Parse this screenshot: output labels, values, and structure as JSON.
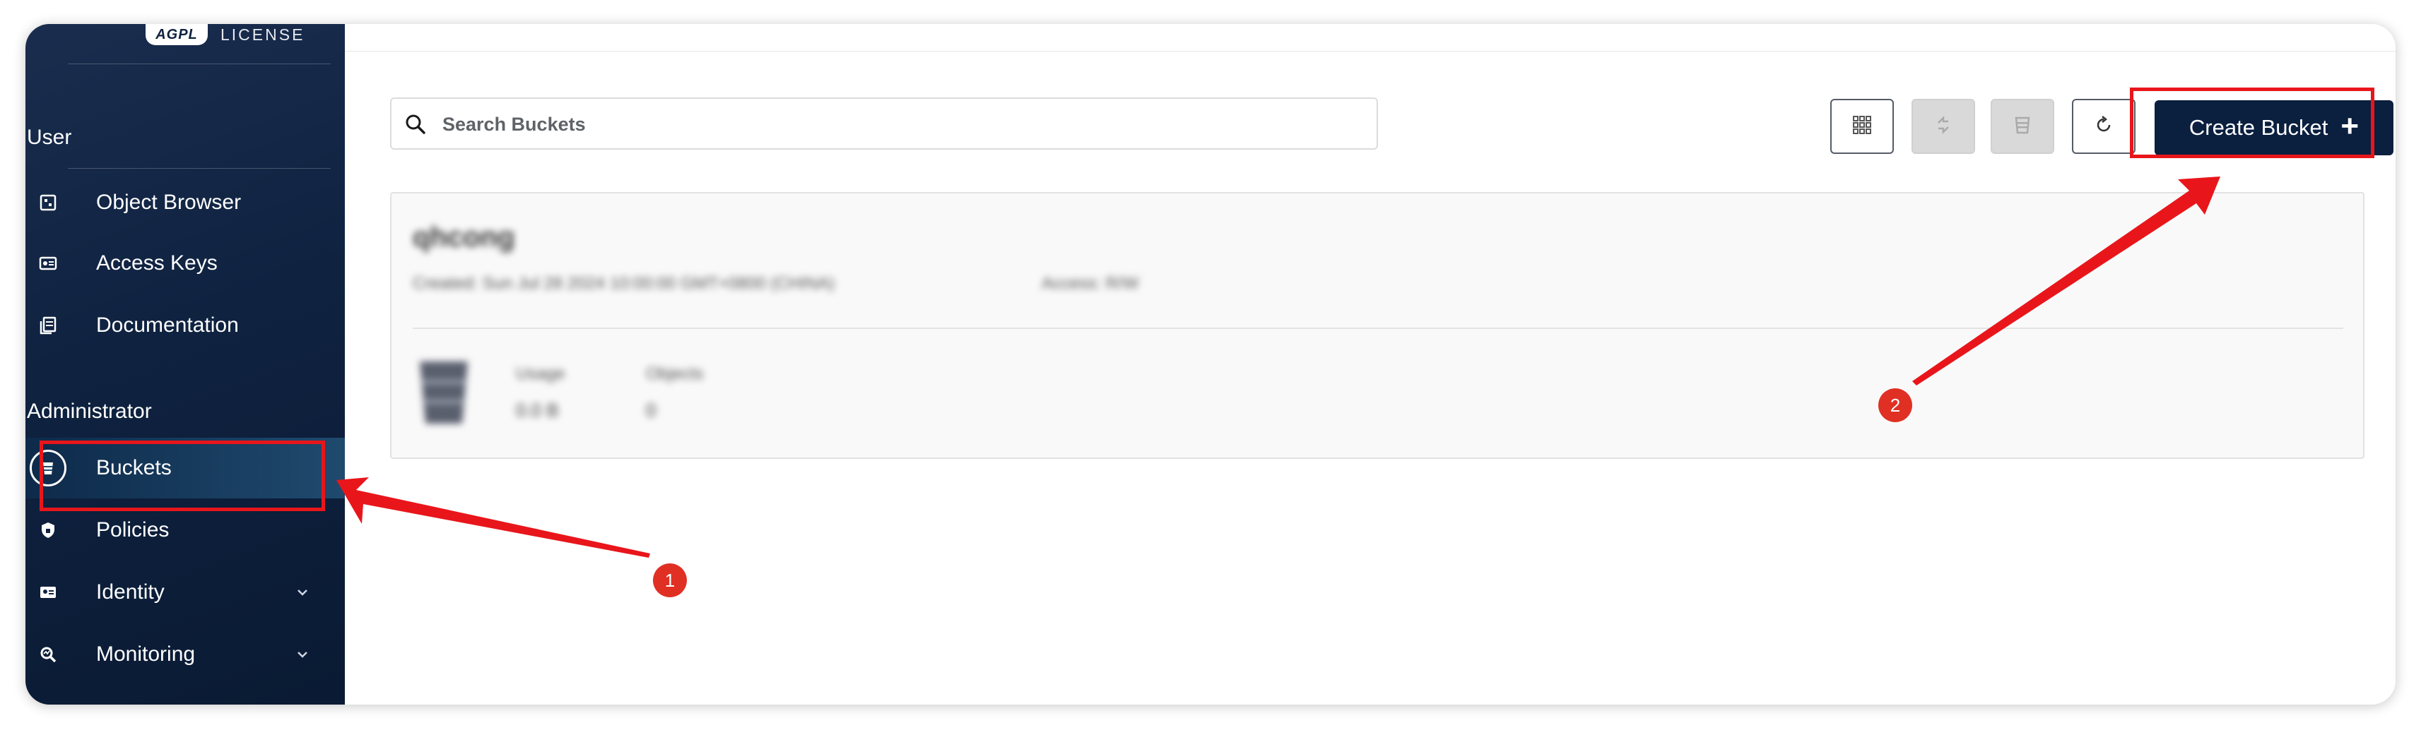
{
  "brand": {
    "logo_text": "AGPL",
    "license_text": "LICENSE"
  },
  "sidebar": {
    "sections": [
      {
        "label": "User"
      },
      {
        "label": "Administrator"
      }
    ],
    "user_items": [
      {
        "label": "Object Browser",
        "icon": "object-browser-icon"
      },
      {
        "label": "Access Keys",
        "icon": "access-keys-icon"
      },
      {
        "label": "Documentation",
        "icon": "documentation-icon"
      }
    ],
    "admin_items": [
      {
        "label": "Buckets",
        "icon": "bucket-icon",
        "active": true
      },
      {
        "label": "Policies",
        "icon": "shield-icon"
      },
      {
        "label": "Identity",
        "icon": "id-card-icon",
        "expandable": true
      },
      {
        "label": "Monitoring",
        "icon": "monitoring-icon",
        "expandable": true
      }
    ]
  },
  "toolbar": {
    "search_placeholder": "Search Buckets",
    "view_toggle_icon": "grid-icon",
    "replicate_icon": "sync-icon",
    "lifecycle_icon": "bucket-stack-icon",
    "refresh_icon": "refresh-icon",
    "create_label": "Create Bucket",
    "create_icon": "plus-icon"
  },
  "bucket_card": {
    "name": "qhcong",
    "meta": "Created: Sun Jul 28 2024 10:00:00 GMT+0800 (CHINA)",
    "access": "Access: R/W",
    "stats": [
      {
        "label": "Usage",
        "value": "0.0 B"
      },
      {
        "label": "Objects",
        "value": "0"
      }
    ]
  },
  "annotations": [
    {
      "label": "1"
    },
    {
      "label": "2"
    }
  ],
  "colors": {
    "sidebar_bg": "#0f2240",
    "primary_button": "#0b1f3f",
    "annotation_red": "#e8161b"
  }
}
